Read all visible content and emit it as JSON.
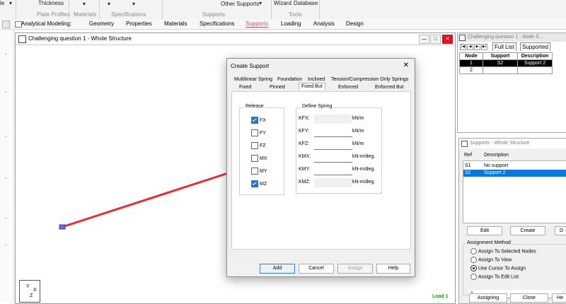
{
  "ribbon": {
    "cut_left": "le",
    "thickness": "Thickness",
    "plate_profiles": "Plate Profiles",
    "materials": "Materials",
    "specifications": "Specifications",
    "other_supports": "Other Supports",
    "supports_group": "Supports",
    "wizard": "Wizard",
    "database": "Database",
    "tools": "Tools"
  },
  "pagebar": {
    "mode": "Analytical Modeling:",
    "tabs": [
      "Geometry",
      "Properties",
      "Materials",
      "Specifications",
      "Supports",
      "Loading",
      "Analysis",
      "Design"
    ],
    "active_tab": "Supports"
  },
  "main_window": {
    "title": "Challenging question 1 - Whole Structure",
    "load_label": "Load 1",
    "axis": {
      "y": "Y",
      "x": "X",
      "z": "Z"
    },
    "member_color": "#e53030"
  },
  "dialog": {
    "title": "Create Support",
    "tabs_row1": [
      "Multilinear Spring",
      "Foundation",
      "Inclined",
      "Tension/Compression Only Springs"
    ],
    "tabs_row2": [
      "Fixed",
      "Pinned",
      "Fixed But",
      "Enforced",
      "Enforced But"
    ],
    "active_tab": "Fixed But",
    "release": {
      "title": "Release",
      "items": [
        {
          "label": "FX",
          "checked": true
        },
        {
          "label": "FY",
          "checked": false
        },
        {
          "label": "FZ",
          "checked": false
        },
        {
          "label": "MX",
          "checked": false
        },
        {
          "label": "MY",
          "checked": false
        },
        {
          "label": "MZ",
          "checked": true
        }
      ]
    },
    "spring": {
      "title": "Define Spring",
      "rows": [
        {
          "label": "KFX:",
          "unit": "kN/m",
          "value": ""
        },
        {
          "label": "KFY:",
          "unit": "kN/m",
          "value": ""
        },
        {
          "label": "KFZ:",
          "unit": "kN/m",
          "value": ""
        },
        {
          "label": "KMX:",
          "unit": "kN-m/deg.",
          "value": ""
        },
        {
          "label": "KMY:",
          "unit": "kN-m/deg.",
          "value": ""
        },
        {
          "label": "KMZ:",
          "unit": "kN-m/deg.",
          "value": ""
        }
      ]
    },
    "buttons": {
      "add": "Add",
      "cancel": "Cancel",
      "assign": "Assign",
      "help": "Help"
    }
  },
  "node_panel": {
    "title": "Challenging question 1 - Node S...",
    "tabs": [
      "Full List",
      "Supported"
    ],
    "headers": [
      "Node",
      "Support",
      "Description"
    ],
    "rows": [
      {
        "node": "1",
        "support": "S2",
        "description": "Support 2"
      },
      {
        "node": "2",
        "support": "",
        "description": ""
      }
    ]
  },
  "supports_panel": {
    "title": "Supports - Whole Structure",
    "col_ref": "Ref",
    "col_desc": "Description",
    "rows": [
      {
        "ref": "S1",
        "desc": "No support"
      },
      {
        "ref": "S2",
        "desc": "Support 2"
      }
    ],
    "selected_index": 1,
    "edit": "Edit",
    "create": "Create",
    "delete_cut": "D",
    "assignment_method": "Assignment Method",
    "methods": [
      "Assign To Selected Nodes",
      "Assign To View",
      "Use Cursor To Assign",
      "Assign To Edit List"
    ],
    "selected_method": "Use Cursor To Assign",
    "edit_list_value": "1",
    "assigning": "Assigning",
    "close": "Close",
    "help_cut": "He"
  },
  "colors": {
    "accent_tab": "#c2507a",
    "selection_blue": "#0a78d7",
    "load_green": "#1a9a1a"
  }
}
